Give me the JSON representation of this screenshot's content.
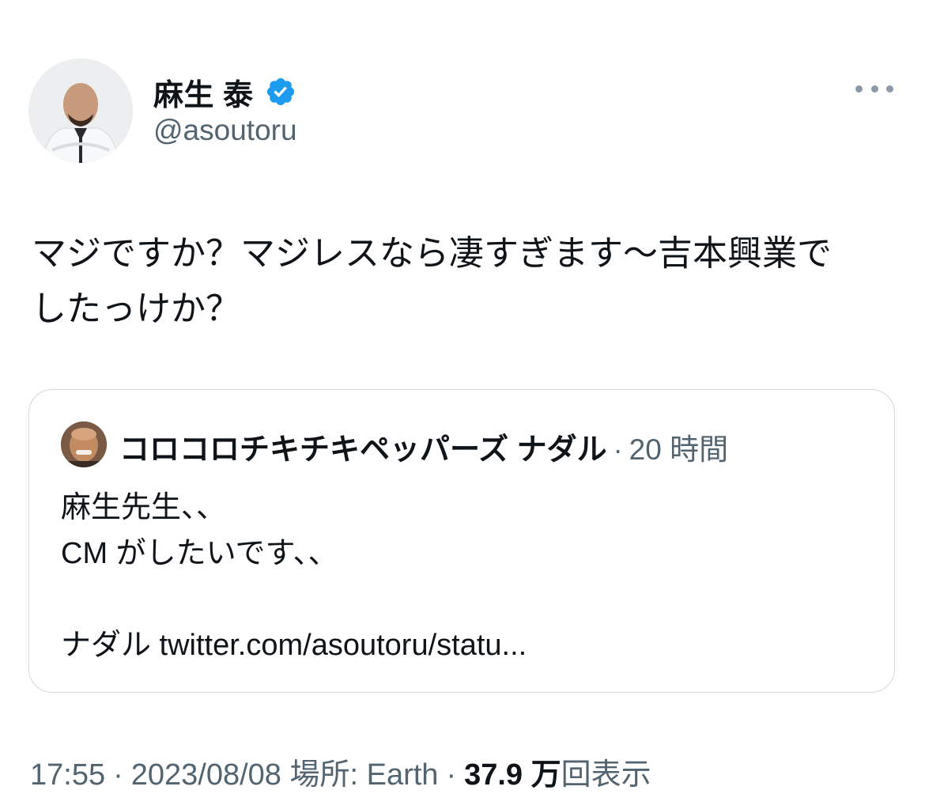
{
  "author": {
    "display_name": "麻生 泰",
    "handle": "@asoutoru",
    "verified_color": "#1d9bf0"
  },
  "tweet": {
    "text": "マジですか？マジレスなら凄すぎます〜吉本興業で\nしたっけか？"
  },
  "quote": {
    "author_name": "コロコロチキチキペッパーズ ナダル",
    "separator": "·",
    "time": "20 時間",
    "text": "麻生先生、、\nCM がしたいです、、\n\nナダル twitter.com/asoutoru/statu..."
  },
  "meta": {
    "time": "17:55",
    "date": "2023/08/08",
    "location": "場所: Earth",
    "views_count": "37.9 万",
    "views_label": "回表示",
    "separator": "·"
  },
  "icons": {
    "verified": "verified-badge-icon",
    "more": "more-horizontal-icon"
  }
}
